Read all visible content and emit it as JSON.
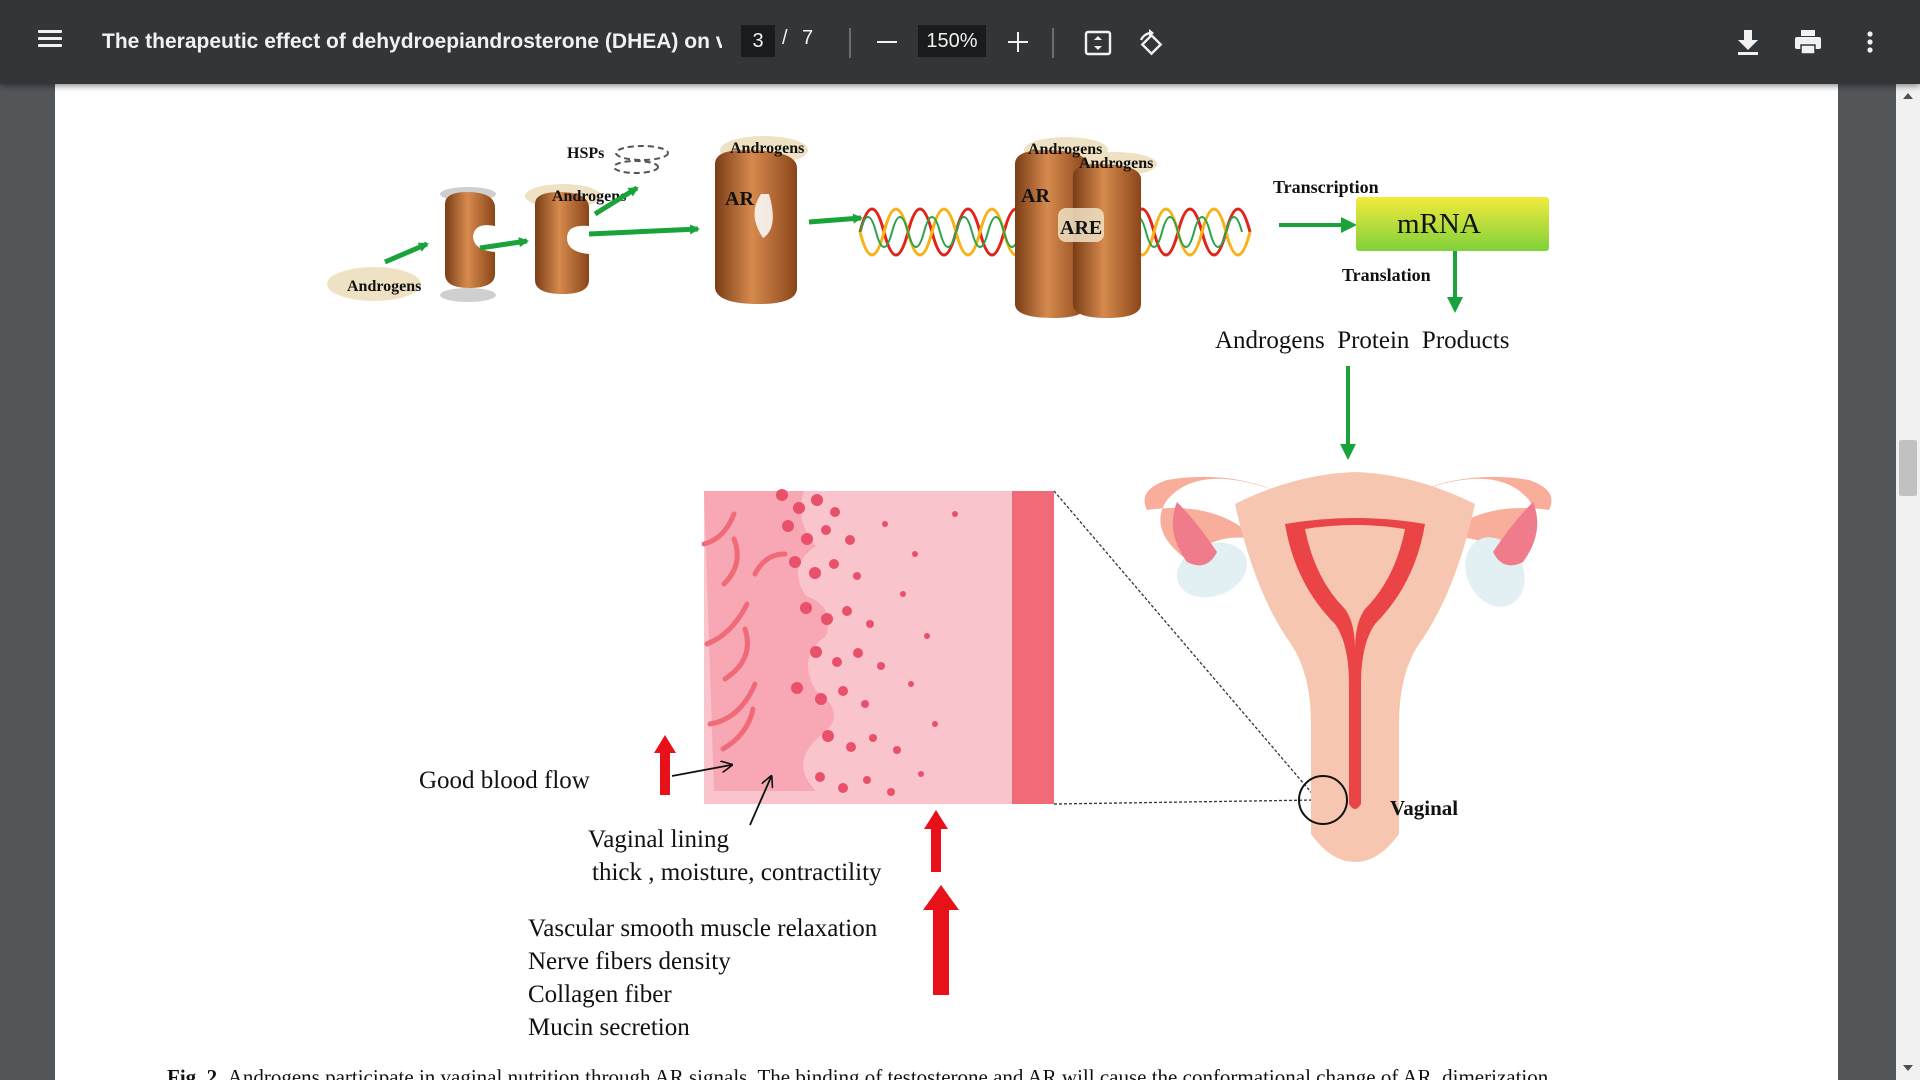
{
  "toolbar": {
    "title": "The therapeutic effect of dehydroepiandrosterone (DHEA) on vu...",
    "current_page": "3",
    "page_separator": "/",
    "total_pages": "7",
    "zoom": "150%",
    "icons": [
      "menu-icon",
      "minus-icon",
      "plus-icon",
      "fit-to-page-icon",
      "rotate-icon",
      "download-icon",
      "print-icon",
      "more-vert-icon"
    ]
  },
  "figure": {
    "labels": {
      "androgens_start": "Androgens",
      "hsps": "HSPs",
      "androgens_bound": "Androgens",
      "androgens_ar": "Androgens",
      "ar_1": "AR",
      "androgens_dimer_1": "Androgens",
      "androgens_dimer_2": "Androgens",
      "ar_2": "AR",
      "are": "ARE",
      "transcription": "Transcription",
      "mrna": "mRNA",
      "translation": "Translation",
      "protein_products": "Androgens  Protein  Products",
      "good_blood_flow": "Good blood flow",
      "vaginal_lining_1": "Vaginal lining",
      "vaginal_lining_2": "thick , moisture, contractility",
      "effect_1": "Vascular smooth muscle relaxation",
      "effect_2": "Nerve fibers density",
      "effect_3": "Collagen fiber",
      "effect_4": "Mucin secretion",
      "vaginal": "Vaginal"
    },
    "colors": {
      "arrow_green": "#1aa33a",
      "arrow_red": "#e8111a",
      "mrna_yellow": "#f3ea3c",
      "mrna_green": "#7fd13b",
      "receptor_brown": "#b0632d",
      "tissue_pink": "#f9c4cc",
      "tissue_dark_pink": "#f06a78",
      "uterus_peach": "#f7c6b0"
    }
  },
  "caption": {
    "fig_label": "Fig. 2",
    "text": "Androgens participate in vaginal nutrition through AR signals. The binding of testosterone and AR will cause the conformational change of AR, dimerization"
  }
}
